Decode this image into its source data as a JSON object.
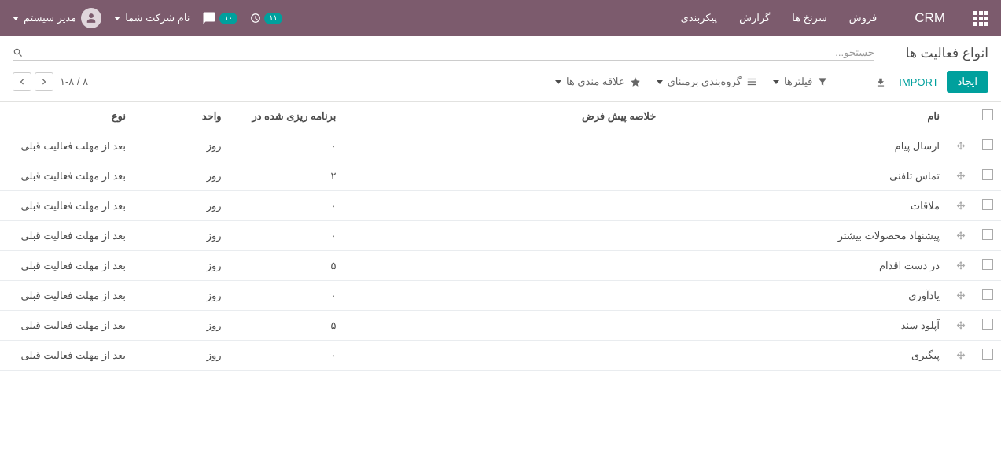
{
  "topbar": {
    "app": "CRM",
    "menus": [
      "فروش",
      "سرنخ ها",
      "گزارش",
      "پیکربندی"
    ],
    "clock_badge": "۱۱",
    "chat_badge": "۱۰",
    "company": "نام شرکت شما",
    "user": "مدیر سیستم"
  },
  "breadcrumb": "انواع فعالیت ها",
  "search": {
    "placeholder": "جستجو..."
  },
  "buttons": {
    "create": "ایجاد",
    "import": "IMPORT"
  },
  "filters": {
    "filter": "فیلترها",
    "group": "گروه‌بندی برمبنای",
    "favorite": "علاقه مندی ها"
  },
  "pager": "۸ / ۱-۸",
  "columns": {
    "name": "نام",
    "summary": "خلاصه پیش فرض",
    "planned": "برنامه ریزی شده در",
    "unit": "واحد",
    "type": "نوع"
  },
  "rows": [
    {
      "name": "ارسال پیام",
      "summary": "",
      "planned": "۰",
      "unit": "روز",
      "type": "بعد از مهلت فعالیت قبلی"
    },
    {
      "name": "تماس تلفنی",
      "summary": "",
      "planned": "۲",
      "unit": "روز",
      "type": "بعد از مهلت فعالیت قبلی"
    },
    {
      "name": "ملاقات",
      "summary": "",
      "planned": "۰",
      "unit": "روز",
      "type": "بعد از مهلت فعالیت قبلی"
    },
    {
      "name": "پیشنهاد محصولات بیشتر",
      "summary": "",
      "planned": "۰",
      "unit": "روز",
      "type": "بعد از مهلت فعالیت قبلی"
    },
    {
      "name": "در دست اقدام",
      "summary": "",
      "planned": "۵",
      "unit": "روز",
      "type": "بعد از مهلت فعالیت قبلی"
    },
    {
      "name": "یادآوری",
      "summary": "",
      "planned": "۰",
      "unit": "روز",
      "type": "بعد از مهلت فعالیت قبلی"
    },
    {
      "name": "آپلود سند",
      "summary": "",
      "planned": "۵",
      "unit": "روز",
      "type": "بعد از مهلت فعالیت قبلی"
    },
    {
      "name": "پیگیری",
      "summary": "",
      "planned": "۰",
      "unit": "روز",
      "type": "بعد از مهلت فعالیت قبلی"
    }
  ]
}
